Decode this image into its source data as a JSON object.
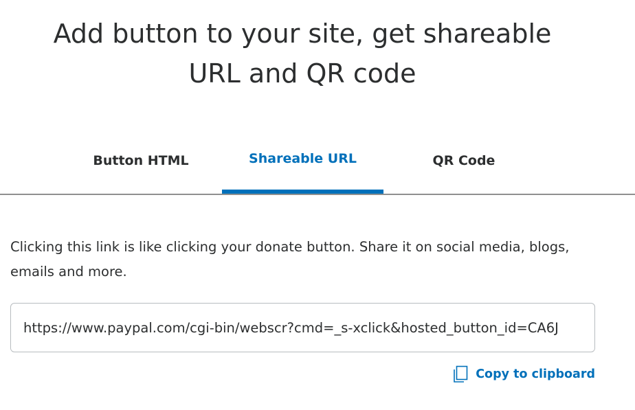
{
  "header": {
    "title_line1": "Add button to your site, get shareable",
    "title_line2": "URL and QR code"
  },
  "tabs": [
    {
      "label": "Button HTML",
      "active": false
    },
    {
      "label": "Shareable URL",
      "active": true
    },
    {
      "label": "QR Code",
      "active": false
    }
  ],
  "description": "Clicking this link is like clicking your donate button. Share it on social media, blogs, emails and more.",
  "url_field": {
    "value": "https://www.paypal.com/cgi-bin/webscr?cmd=_s-xclick&hosted_button_id=CA6J"
  },
  "copy": {
    "label": "Copy to clipboard",
    "icon": "copy-icon"
  },
  "colors": {
    "accent": "#0070ba",
    "text": "#2c2e2f",
    "divider": "#8f8f8f",
    "field_border": "#b7bcbf"
  }
}
